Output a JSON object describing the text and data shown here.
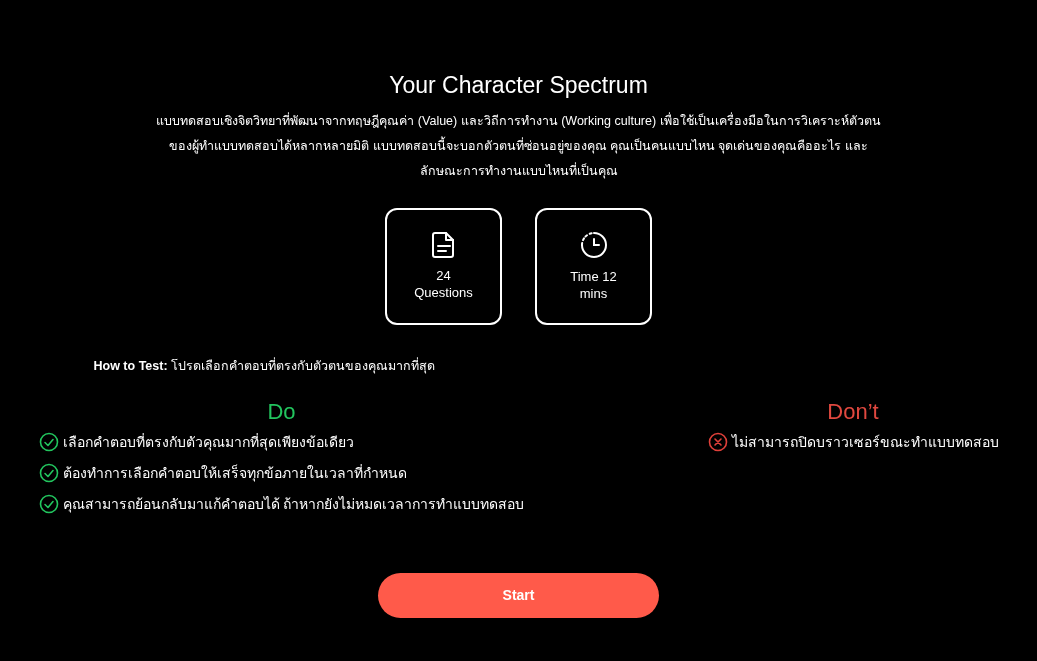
{
  "title": "Your Character Spectrum",
  "description": "แบบทดสอบเชิงจิตวิทยาที่พัฒนาจากทฤษฎีคุณค่า (Value) และวิถีการทำงาน (Working culture) เพื่อใช้เป็นเครื่องมือในการวิเคราะห์ตัวตนของผู้ทำแบบทดสอบได้หลากหลายมิติ แบบทดสอบนี้จะบอกตัวตนที่ซ่อนอยู่ของคุณ คุณเป็นคนแบบไหน จุดเด่นของคุณคืออะไร และลักษณะการทำงานแบบไหนที่เป็นคุณ",
  "info_cards": [
    {
      "kind": "questions",
      "lines": [
        "24",
        "Questions"
      ]
    },
    {
      "kind": "time",
      "lines": [
        "Time 12",
        "mins"
      ]
    }
  ],
  "instructions": "**How to Test:** โปรดเลือกคำตอบที่ตรงกับตัวตนของคุณมากที่สุด",
  "rules": [
    {
      "kind": "do",
      "heading": "Do",
      "items": [
        "เลือกคำตอบที่ตรงกับตัวคุณมากที่สุดเพียงข้อเดียว",
        "ต้องทำการเลือกคำตอบให้เสร็จทุกข้อภายในเวลาที่กำหนด",
        "คุณสามารถย้อนกลับมาแก้คำตอบได้ ถ้าหากยังไม่หมดเวลาการทำแบบทดสอบ"
      ]
    },
    {
      "kind": "dont",
      "heading": "Don’t",
      "items": [
        "ไม่สามารถปิดบราวเซอร์ขณะทำแบบทดสอบ"
      ]
    }
  ],
  "start_button": "Start"
}
